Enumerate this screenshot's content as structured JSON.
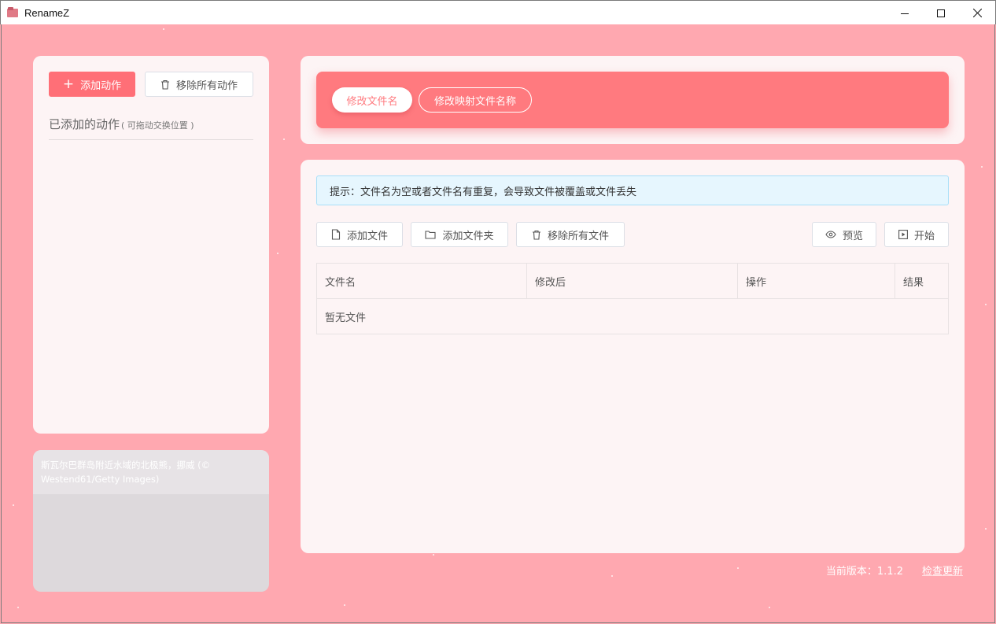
{
  "window": {
    "title": "RenameZ",
    "controls": [
      "minimize",
      "maximize",
      "close"
    ]
  },
  "left_panel": {
    "add_action_label": "添加动作",
    "remove_all_actions_label": "移除所有动作",
    "actions_title": "已添加的动作",
    "actions_hint": "( 可拖动交换位置 )"
  },
  "image_card": {
    "caption": "斯瓦尔巴群岛附近水域的北极熊，挪威 (© Westend61/Getty Images)"
  },
  "tabs": [
    {
      "label": "修改文件名",
      "active": true
    },
    {
      "label": "修改映射文件名称",
      "active": false
    }
  ],
  "alert": {
    "text": "提示：文件名为空或者文件名有重复，会导致文件被覆盖或文件丢失"
  },
  "toolbar": {
    "add_file_label": "添加文件",
    "add_folder_label": "添加文件夹",
    "remove_all_files_label": "移除所有文件",
    "preview_label": "预览",
    "start_label": "开始"
  },
  "table": {
    "columns": [
      "文件名",
      "修改后",
      "操作",
      "结果"
    ],
    "empty_text": "暂无文件"
  },
  "footer": {
    "version_text": "当前版本：1.1.2",
    "check_update_label": "检查更新"
  },
  "colors": {
    "background": "#ffa8b0",
    "accent": "#ff7a7f",
    "primary_button": "#ff6f77",
    "card": "#fdf4f5",
    "alert_bg": "#e6f6fe"
  },
  "icons": [
    "plus-icon",
    "trash-icon",
    "file-icon",
    "folder-icon",
    "eye-icon",
    "play-icon"
  ]
}
